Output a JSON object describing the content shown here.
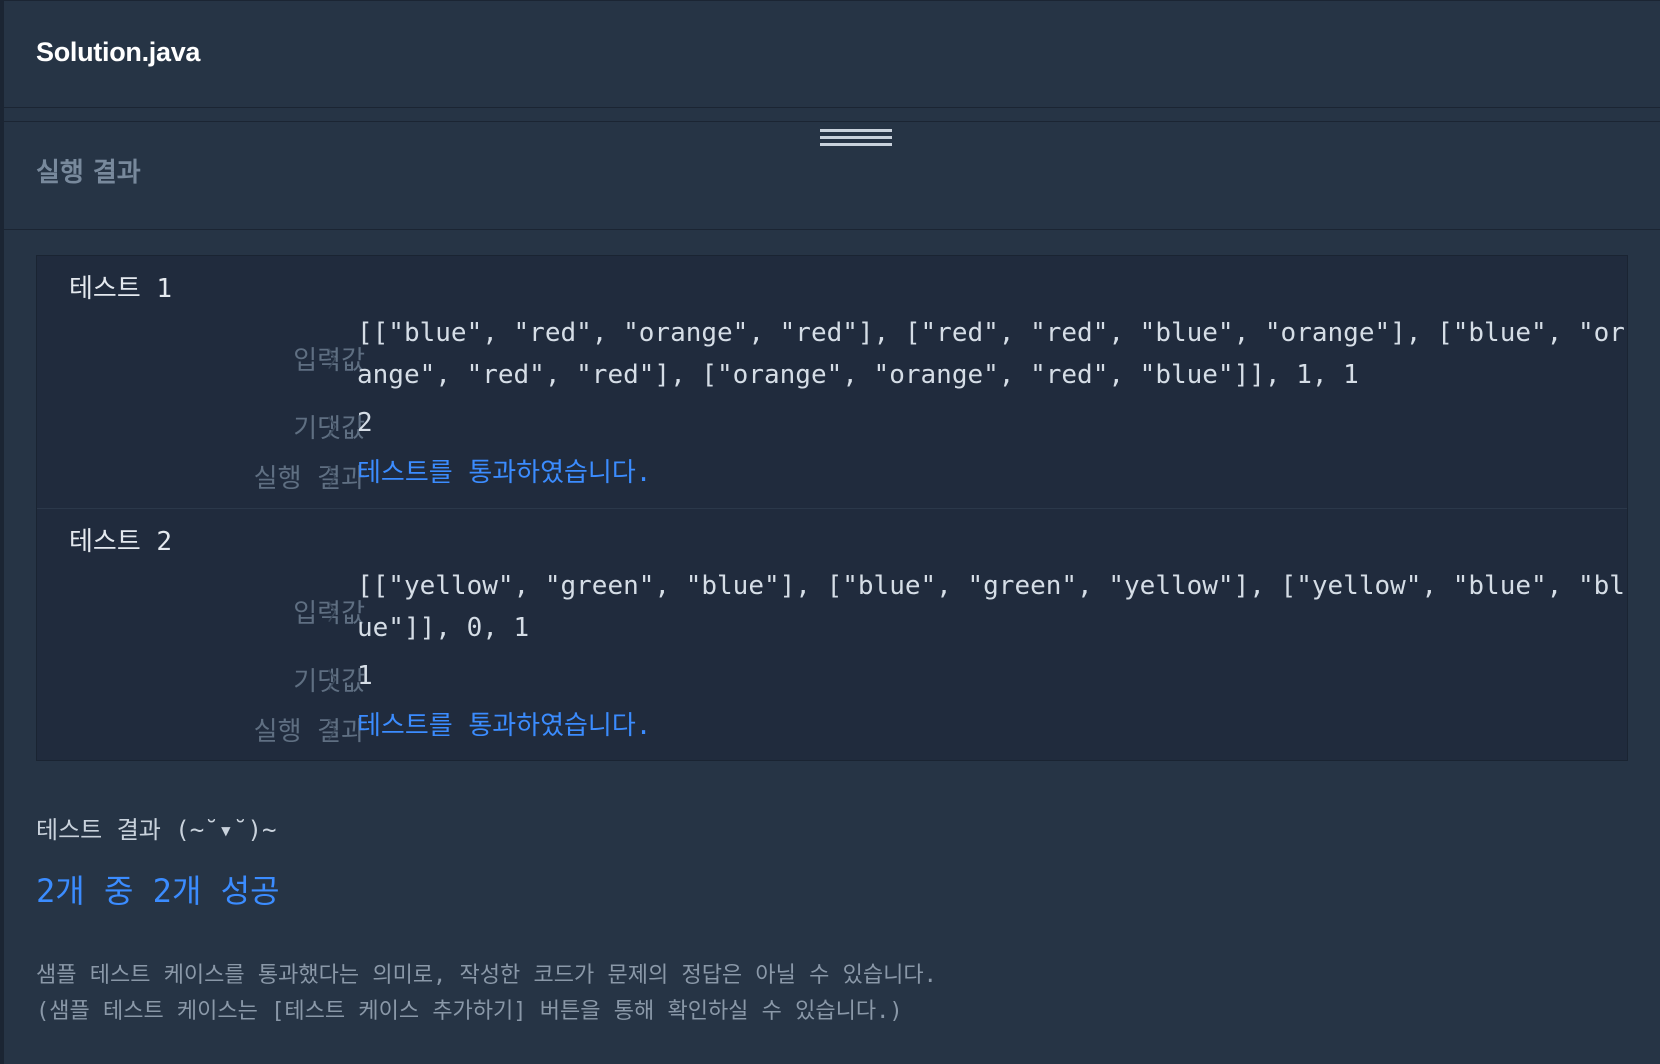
{
  "editor": {
    "file_name": "Solution.java"
  },
  "results_panel": {
    "title": "실행 결과",
    "tests": [
      {
        "title": "테스트 1",
        "input_label": "입력값",
        "input": "[[\"blue\", \"red\", \"orange\", \"red\"], [\"red\", \"red\", \"blue\", \"orange\"], [\"blue\", \"orange\", \"red\", \"red\"], [\"orange\", \"orange\", \"red\", \"blue\"]], 1, 1",
        "expected_label": "기댓값",
        "expected": "2",
        "result_label": "실행 결과",
        "result": "테스트를 통과하였습니다."
      },
      {
        "title": "테스트 2",
        "input_label": "입력값",
        "input": "[[\"yellow\", \"green\", \"blue\"], [\"blue\", \"green\", \"yellow\"], [\"yellow\", \"blue\", \"blue\"]], 0, 1",
        "expected_label": "기댓값",
        "expected": "1",
        "result_label": "실행 결과",
        "result": "테스트를 통과하였습니다."
      }
    ],
    "separator_glyph": "〉",
    "summary_label": "테스트 결과 (~˘▾˘)~",
    "summary_count": "2개 중 2개 성공",
    "notice_line1": "샘플 테스트 케이스를 통과했다는 의미로, 작성한 코드가 문제의 정답은 아닐 수 있습니다.",
    "notice_line2": "(샘플 테스트 케이스는 [테스트 케이스 추가하기] 버튼을 통해 확인하실 수 있습니다.)"
  },
  "colors": {
    "background": "#263445",
    "results_box": "#202b3d",
    "pass_text": "#3b8cff",
    "muted_text": "#5f6f82"
  }
}
